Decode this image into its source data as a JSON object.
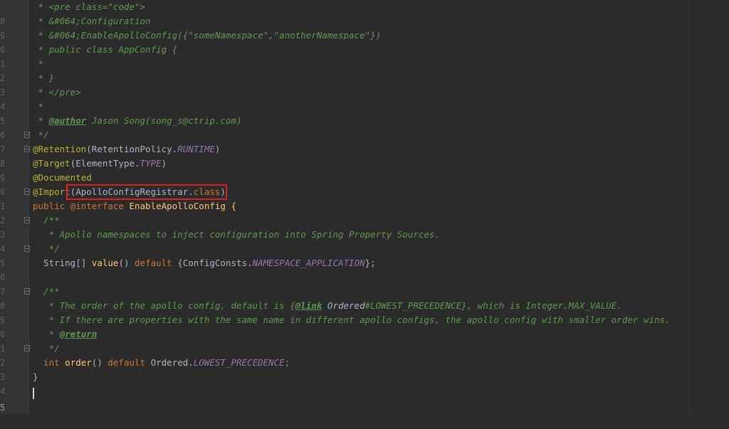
{
  "gutter_numbers": [
    "8",
    "9",
    "0",
    "1",
    "2",
    "3",
    "4",
    "5",
    "6",
    "7",
    "8",
    "9",
    "0",
    "1",
    "2",
    "3",
    "4",
    "5",
    "6",
    "7",
    "8",
    "9",
    "0",
    "1",
    "2",
    "3",
    "4",
    "5"
  ],
  "code": {
    "l1_a": " * <pre class=\"code\">",
    "l2_a": " * &#064;Configuration",
    "l3_a": " * &#064;EnableApolloConfig({\"someNamespace\",\"anotherNamespace\"})",
    "l4_a": " * public class AppConfig {",
    "l5_a": " *",
    "l6_a": " * }",
    "l7_a": " * </pre>",
    "l8_a": " *",
    "l9_a": " * ",
    "l9_tag": "@author",
    "l9_b": " Jason Song(song_s@ctrip.com)",
    "l10_a": " */",
    "l11_ann": "@Retention",
    "l11_b": "(RetentionPolicy.",
    "l11_c": "RUNTIME",
    "l11_d": ")",
    "l12_ann": "@Target",
    "l12_b": "(ElementType.",
    "l12_c": "TYPE",
    "l12_d": ")",
    "l13_ann": "@Documented",
    "l14_ann": "@Import",
    "l14_b": "(ApolloConfigRegistrar.",
    "l14_c": "class",
    "l14_d": ")",
    "l15_kw": "public @interface",
    "l15_b": " EnableApolloConfig {",
    "l16_a": "  /**",
    "l17_a": "   * Apollo namespaces to inject configuration into Spring Property Sources.",
    "l18_a": "   */",
    "l19_a": "  String[] ",
    "l19_fn": "value",
    "l19_b": "() ",
    "l19_kw": "default",
    "l19_c": " {ConfigConsts.",
    "l19_const": "NAMESPACE_APPLICATION",
    "l19_d": "};",
    "l20_a": "",
    "l21_a": "  /**",
    "l22_a": "   * The order of the apollo config, default is {",
    "l22_tag": "@link",
    "l22_b": " Ordered",
    "l22_c": "#LOWEST_PRECEDENCE}, which is Integer.MAX_VALUE.",
    "l23_a": "   * If there are properties with the same name in different apollo configs, the apollo config with smaller order wins.",
    "l24_a": "   * ",
    "l24_tag": "@return",
    "l25_a": "   */",
    "l26_kw": "  int",
    "l26_fn": " order",
    "l26_b": "() ",
    "l26_kw2": "default",
    "l26_c": " Ordered.",
    "l26_const": "LOWEST_PRECEDENCE",
    "l26_d": ";",
    "l27_a": "}"
  }
}
